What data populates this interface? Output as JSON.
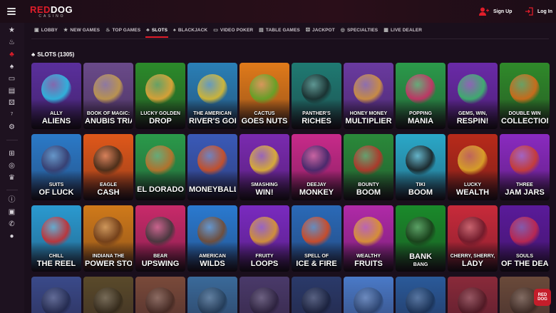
{
  "brand": {
    "logo_part1": "RED",
    "logo_part2": "DOG",
    "logo_sub": "CASINO"
  },
  "header": {
    "signup_label": "Sign Up",
    "login_label": "Log In"
  },
  "sidebar": {
    "icons": [
      "star-icon",
      "flame-icon",
      "slots-icon",
      "spade-icon",
      "video-poker-icon",
      "jackpot-icon",
      "dice-icon",
      "table-games-icon",
      "live-dealer-icon",
      "gift-icon",
      "target-icon",
      "trophy-icon",
      "info-icon",
      "news-icon",
      "phone-icon",
      "chat-icon"
    ]
  },
  "tabs": [
    {
      "label": "LOBBY",
      "icon": "lobby-icon"
    },
    {
      "label": "NEW GAMES",
      "icon": "star-icon"
    },
    {
      "label": "TOP GAMES",
      "icon": "flame-icon"
    },
    {
      "label": "SLOTS",
      "icon": "slots-icon"
    },
    {
      "label": "BLACKJACK",
      "icon": "spade-icon"
    },
    {
      "label": "VIDEO POKER",
      "icon": "video-poker-icon"
    },
    {
      "label": "TABLE GAMES",
      "icon": "table-games-icon"
    },
    {
      "label": "JACKPOT",
      "icon": "jackpot-icon"
    },
    {
      "label": "SPECIALTIES",
      "icon": "specialties-icon"
    },
    {
      "label": "LIVE DEALER",
      "icon": "live-dealer-icon"
    }
  ],
  "section": {
    "title": "SLOTS (1305)"
  },
  "games": [
    {
      "t1": "ALLY",
      "t2": "ALIENS",
      "bg": "#5a2f9c",
      "accent": "#2cc6e8"
    },
    {
      "t1": "BOOK OF MAGIC:",
      "t2": "ANUBIS TRIAL",
      "bg": "#6a4a8a",
      "accent": "#c9a14a"
    },
    {
      "t1": "LUCKY GOLDEN",
      "t2": "DROP",
      "bg": "#2b8a2a",
      "accent": "#f2a83a"
    },
    {
      "t1": "THE AMERICAN",
      "t2": "RIVER'S GOLD",
      "bg": "#2a7fb6",
      "accent": "#e6c02a"
    },
    {
      "t1": "CACTUS",
      "t2": "GOES NUTS",
      "bg": "#e07a1a",
      "accent": "#5aa82a"
    },
    {
      "t1": "PANTHER'S",
      "t2": "RICHES",
      "bg": "#1f7a72",
      "accent": "#1a2a2a"
    },
    {
      "t1": "HONEY MONEY",
      "t2": "MULTIPLIER",
      "bg": "#6a3aa0",
      "accent": "#d99a3a"
    },
    {
      "t1": "POPPING",
      "t2": "MANIA",
      "bg": "#2b9a4a",
      "accent": "#d62a6a"
    },
    {
      "t1": "GEMS, WIN,",
      "t2": "RESPIN!",
      "bg": "#6a2aa8",
      "accent": "#3ac06a"
    },
    {
      "t1": "DOUBLE WIN",
      "t2": "COLLECTION",
      "bg": "#2f8a2a",
      "accent": "#e06a1a"
    },
    {
      "t1": "SUITS",
      "t2": "OF LUCK",
      "bg": "#2b7ac8",
      "accent": "#3a3a6a"
    },
    {
      "t1": "EAGLE",
      "t2": "CASH",
      "bg": "#e0581a",
      "accent": "#3a2a1a"
    },
    {
      "t1": "",
      "t2": "EL DORADO",
      "bg": "#2a9a4a",
      "accent": "#c8702a"
    },
    {
      "t1": "",
      "t2": "MONEYBALL",
      "bg": "#3a5ab8",
      "accent": "#d8501a"
    },
    {
      "t1": "SMASHING",
      "t2": "WIN!",
      "bg": "#7a2ab0",
      "accent": "#e8c02a"
    },
    {
      "t1": "DEEJAY",
      "t2": "MONKEY",
      "bg": "#c82a8a",
      "accent": "#3a2a6a"
    },
    {
      "t1": "BOUNTY",
      "t2": "BOOM",
      "bg": "#2a8a3a",
      "accent": "#c0302a"
    },
    {
      "t1": "TIKI",
      "t2": "BOOM",
      "bg": "#2aa8c8",
      "accent": "#1a1a1a"
    },
    {
      "t1": "LUCKY",
      "t2": "WEALTH",
      "bg": "#b82a1a",
      "accent": "#e0b02a"
    },
    {
      "t1": "THREE",
      "t2": "JAM JARS",
      "bg": "#8a2ac0",
      "accent": "#d0402a"
    },
    {
      "t1": "CHILL",
      "t2": "THE REEL",
      "bg": "#2a9ad0",
      "accent": "#d02a2a"
    },
    {
      "t1": "INDIANA THE",
      "t2": "POWER STONE",
      "bg": "#d07a1a",
      "accent": "#6a3a1a"
    },
    {
      "t1": "BEAR",
      "t2": "UPSWING",
      "bg": "#c82a6a",
      "accent": "#3a3a3a"
    },
    {
      "t1": "AMERICAN",
      "t2": "WILDS",
      "bg": "#2a7ad0",
      "accent": "#7a4a2a"
    },
    {
      "t1": "FRUITY",
      "t2": "LOOPS",
      "bg": "#7a2ac0",
      "accent": "#e0a02a"
    },
    {
      "t1": "SPELL OF",
      "t2": "ICE & FIRE",
      "bg": "#2a6ab8",
      "accent": "#e04a1a"
    },
    {
      "t1": "WEALTHY",
      "t2": "FRUITS",
      "bg": "#b02aa8",
      "accent": "#e0a02a"
    },
    {
      "t1": "",
      "t2": "BANK",
      "bg": "#1a8a2a",
      "accent": "#1a3a1a",
      "t3": "BANG"
    },
    {
      "t1": "CHERRY, SHERRY,",
      "t2": "LADY",
      "bg": "#c82a3a",
      "accent": "#6a1a2a"
    },
    {
      "t1": "SOULS",
      "t2": "OF THE DEAD",
      "bg": "#5a1a9a",
      "accent": "#c82a4a"
    }
  ],
  "row4": [
    "#3a4a8a",
    "#5a4a2a",
    "#7a4a3a",
    "#3a6a9a",
    "#4a3a6a",
    "#2a3a6a",
    "#4a7ac8",
    "#2a5a9a",
    "#8a2a3a",
    "#6a4a3a"
  ],
  "fab": {
    "line1": "RED",
    "line2": "DOG"
  }
}
